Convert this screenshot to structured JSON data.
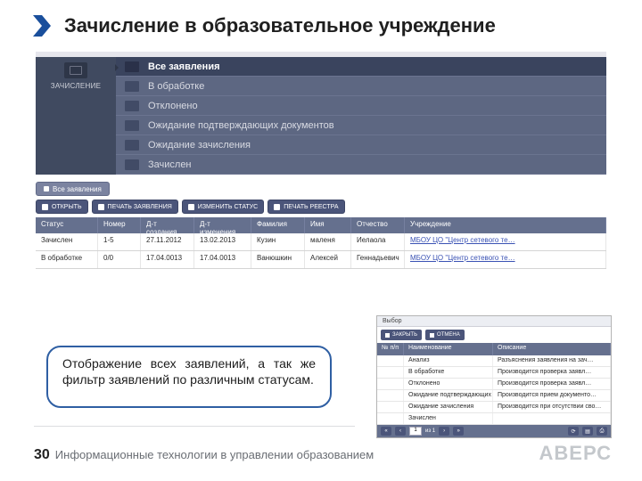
{
  "slide": {
    "title": "Зачисление в образовательное учреждение",
    "callout": "Отображение всех заявлений, а так же фильтр заявлений по различным статусам.",
    "page_number": "30",
    "footer": "Информационные технологии в управлении образованием",
    "brand": "АВЕРС"
  },
  "left_nav": {
    "label": "ЗАЧИСЛЕНИЕ"
  },
  "menu": [
    "Все заявления",
    "В обработке",
    "Отклонено",
    "Ожидание подтверждающих документов",
    "Ожидание зачисления",
    "Зачислен"
  ],
  "tag": "Все заявления",
  "toolbar": [
    "ОТКРЫТЬ",
    "ПЕЧАТЬ ЗАЯВЛЕНИЯ",
    "ИЗМЕНИТЬ СТАТУС",
    "ПЕЧАТЬ РЕЕСТРА"
  ],
  "table": {
    "headers": [
      "Статус",
      "Номер",
      "Д-т создания",
      "Д-т изменения",
      "Фамилия",
      "Имя",
      "Отчество",
      "Учреждение"
    ],
    "rows": [
      [
        "Зачислен",
        "1-5",
        "27.11.2012",
        "13.02.2013",
        "Кузин",
        "маленя",
        "Иелаола",
        "МБОУ ЦО \"Центр сетевого те…"
      ],
      [
        "В обработке",
        "0/0",
        "17.04.0013",
        "17.04.0013",
        "Ванюшкин",
        "Алексей",
        "Геннадьевич",
        "МБОУ ЦО \"Центр сетевого те…"
      ]
    ]
  },
  "mini": {
    "title": "Выбор",
    "buttons": [
      "ЗАКРЫТЬ",
      "ОТМЕНА"
    ],
    "headers": [
      "№ п/п",
      "Наименование",
      "Описание"
    ],
    "rows": [
      [
        "",
        "Анализ",
        "Разъяснения заявления на зач…"
      ],
      [
        "",
        "В обработке",
        "Производится проверка заявл…"
      ],
      [
        "",
        "Отклонено",
        "Производится проверка заявл…"
      ],
      [
        "",
        "Ожидание подтверждающих доку…",
        "Производится прием документо…"
      ],
      [
        "",
        "Ожидание зачисления",
        "Производится при отсутствии сво…"
      ],
      [
        "",
        "Зачислен",
        ""
      ]
    ],
    "page_input": "1",
    "page_total": "из 1"
  }
}
